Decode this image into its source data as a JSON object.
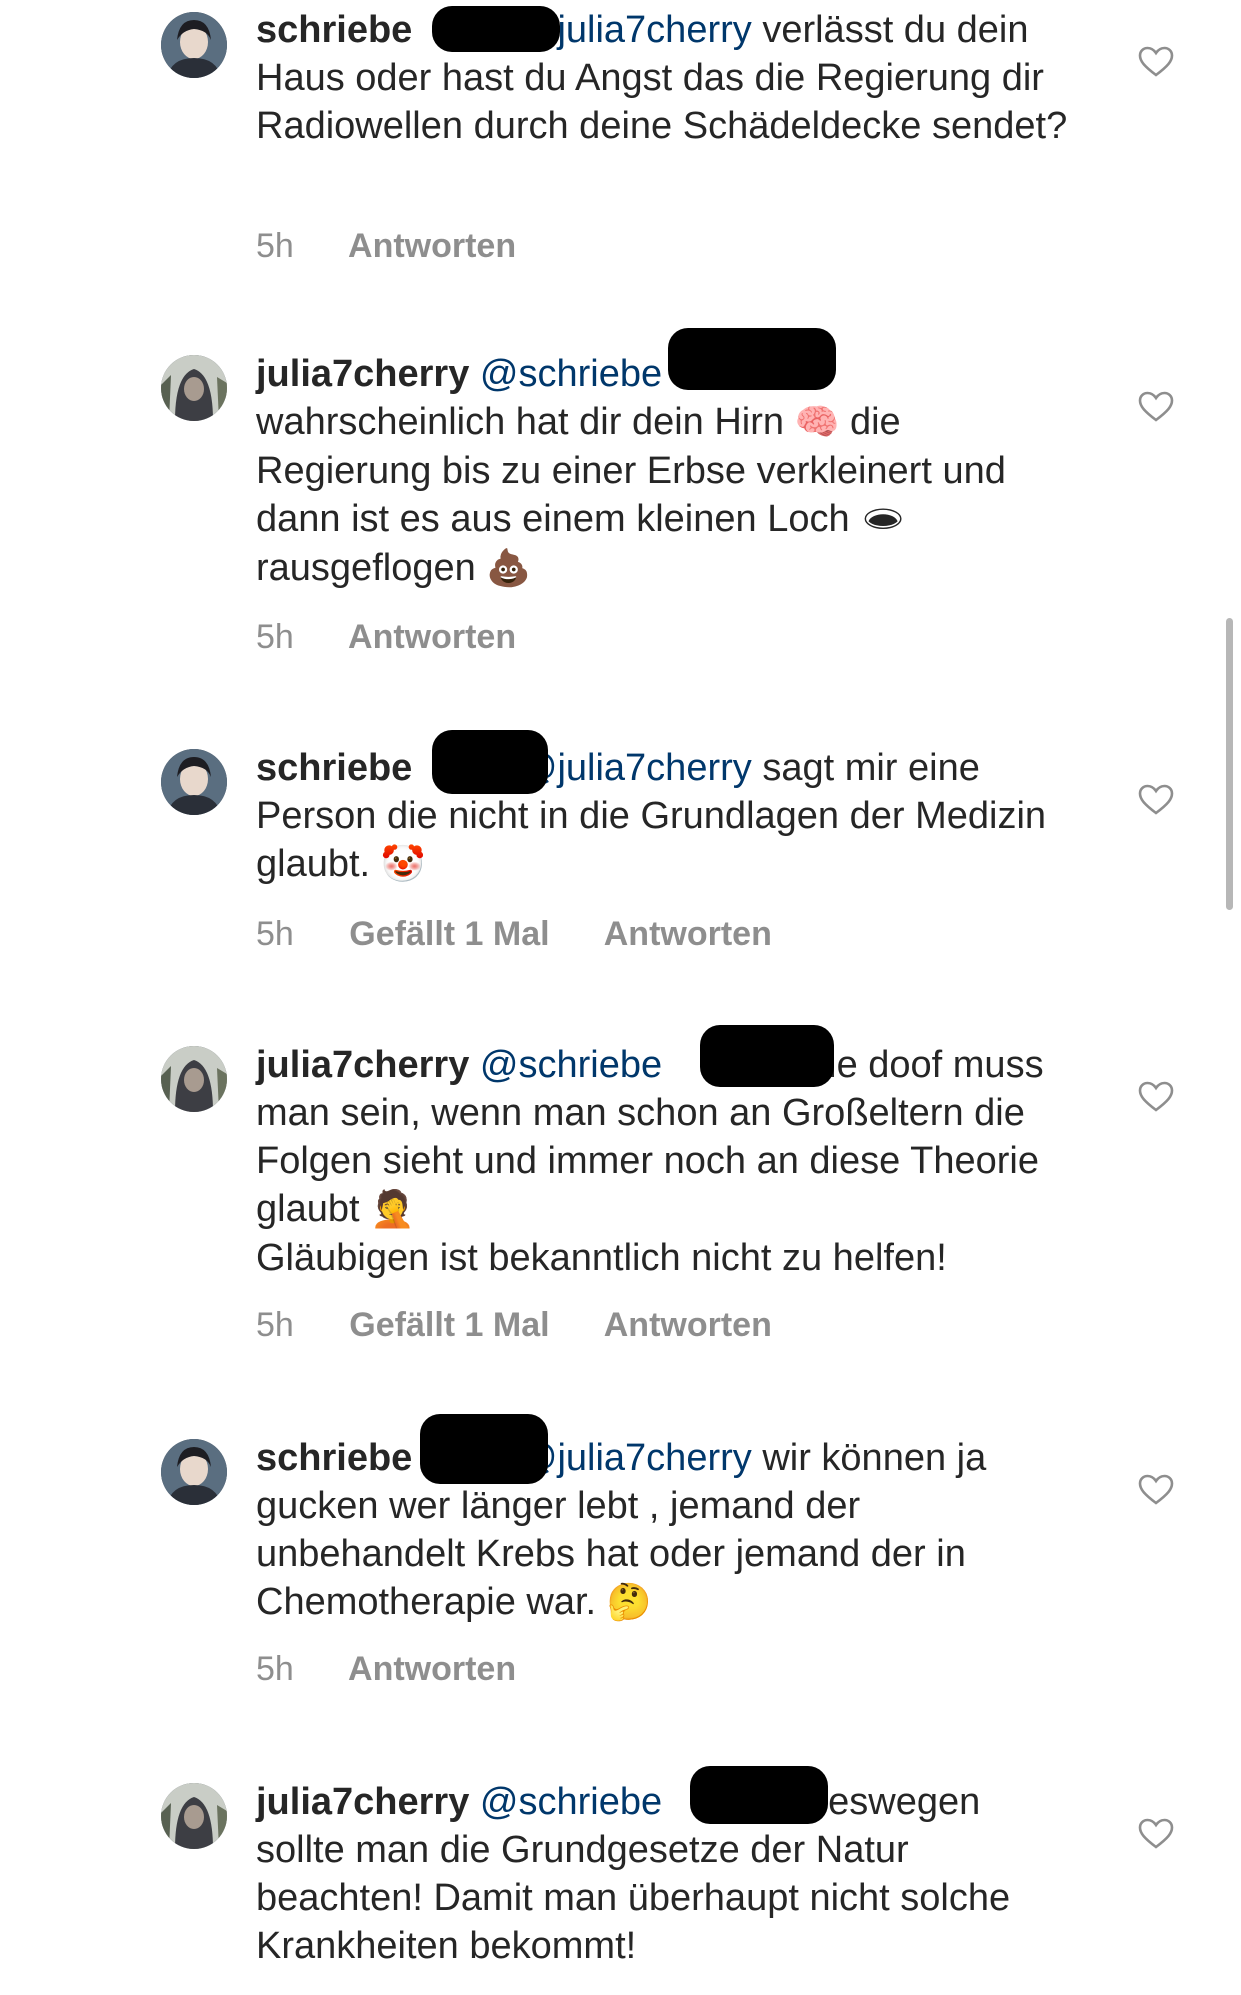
{
  "comments": [
    {
      "user": "schriebe",
      "mention": "@julia7cherry",
      "text": "verlässt du dein Haus oder hast du Angst das die Regierung dir Radiowellen durch deine Schädeldecke sendet?",
      "time": "5h",
      "likes": "",
      "reply": "Antworten"
    },
    {
      "user": "julia7cherry",
      "mention": "@schriebe",
      "text_a": "wahrscheinlich hat dir dein Hirn",
      "emoji_a": "🧠",
      "text_b": "die Regierung bis zu einer Erbse verkleinert und dann ist es aus einem kleinen Loch",
      "emoji_b": "🕳",
      "text_c": "rausgeflogen",
      "emoji_c": "💩",
      "time": "5h",
      "reply": "Antworten"
    },
    {
      "user": "schriebe",
      "mention": "@julia7cherry",
      "text": "sagt mir eine Person die nicht in die Grundlagen der Medizin glaubt.",
      "emoji": "🤡",
      "time": "5h",
      "likes": "Gefällt 1 Mal",
      "reply": "Antworten"
    },
    {
      "user": "julia7cherry",
      "mention": "@schriebe",
      "text_a": "wie doof muss man sein, wenn man schon an Großeltern die Folgen sieht und immer noch an diese Theorie glaubt",
      "emoji": "🤦",
      "text_b": "Gläubigen ist bekanntlich nicht zu helfen!",
      "time": "5h",
      "likes": "Gefällt 1 Mal",
      "reply": "Antworten"
    },
    {
      "user": "schriebe",
      "mention": "@julia7cherry",
      "text": "wir können ja gucken wer länger lebt , jemand der unbehandelt Krebs hat oder jemand der in Chemotherapie war.",
      "emoji": "🤔",
      "time": "5h",
      "reply": "Antworten"
    },
    {
      "user": "julia7cherry",
      "mention": "@schriebe",
      "text": "Deswegen sollte man die Grundgesetze der Natur beachten! Damit man überhaupt nicht solche Krankheiten bekommt!"
    }
  ],
  "icons": {
    "like": "heart-outline-icon",
    "avatar_a": "user-avatar-hoodie",
    "avatar_b": "user-avatar-hood-forest"
  }
}
